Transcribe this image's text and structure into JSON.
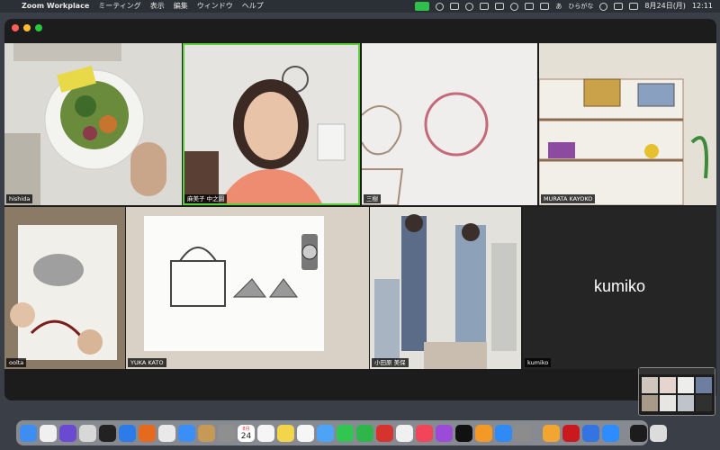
{
  "menubar": {
    "app_name": "Zoom Workplace",
    "items": [
      "ミーティング",
      "表示",
      "編集",
      "ウィンドウ",
      "ヘルプ"
    ],
    "input_method": "あ",
    "input_method_label": "ひらがな",
    "date": "8月24日(月)",
    "time": "12:11"
  },
  "participants": [
    {
      "name": "hishida"
    },
    {
      "name": "麻美子 中之園"
    },
    {
      "name": "三樹"
    },
    {
      "name": "MURATA KAYOKO"
    },
    {
      "name": "oolta"
    },
    {
      "name": "YUKA KATO"
    },
    {
      "name": "小田原 美保"
    },
    {
      "name": "kumiko"
    }
  ],
  "kumiko_display_name": "kumiko",
  "colors": {
    "active_speaker_border": "#5ccf3d"
  },
  "dock": {
    "calendar_month": "8月",
    "calendar_day": "24",
    "icons": [
      "finder-icon",
      "notes-icon",
      "siri-icon",
      "launchpad-icon",
      "calculator-icon",
      "safari-icon",
      "firefox-icon",
      "chrome-icon",
      "mail-icon",
      "photos-icon",
      "contacts-icon",
      "calendar-icon",
      "reminders-icon",
      "stickies-icon",
      "freeform-icon",
      "maps-icon",
      "messages-icon",
      "facetime-icon",
      "photo-booth-icon",
      "photos-app-icon",
      "music-icon",
      "podcasts-icon",
      "tv-icon",
      "books-icon",
      "appstore-icon",
      "system-settings-icon",
      "pages-icon",
      "acrobat-icon",
      "keynote-icon",
      "zoom-icon",
      "document-icon",
      "trash-icon"
    ]
  }
}
